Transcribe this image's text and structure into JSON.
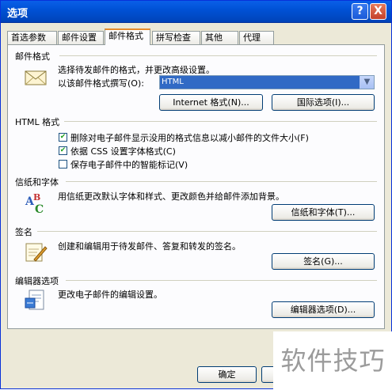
{
  "window": {
    "title": "选项"
  },
  "titlebar": {
    "help_label": "?",
    "close_label": "X"
  },
  "tabs": [
    {
      "label": "首选参数"
    },
    {
      "label": "邮件设置"
    },
    {
      "label": "邮件格式"
    },
    {
      "label": "拼写检查"
    },
    {
      "label": "其他"
    },
    {
      "label": "代理"
    }
  ],
  "mail_format": {
    "title": "邮件格式",
    "desc": "选择待发邮件的格式，并更改高级设置。",
    "compose_label": "以该邮件格式撰写(O):",
    "compose_value": "HTML",
    "internet_button": "Internet 格式(N)...",
    "international_button": "国际选项(I)..."
  },
  "html_format": {
    "title": "HTML 格式",
    "options": [
      {
        "label": "删除对电子邮件显示没用的格式信息以减小邮件的文件大小(F)",
        "checked": true
      },
      {
        "label": "依据 CSS 设置字体格式(C)",
        "checked": true
      },
      {
        "label": "保存电子邮件中的智能标记(V)",
        "checked": false
      }
    ]
  },
  "stationery": {
    "title": "信纸和字体",
    "desc": "用信纸更改默认字体和样式、更改颜色并给邮件添加背景。",
    "button": "信纸和字体(T)..."
  },
  "signature": {
    "title": "签名",
    "desc": "创建和编辑用于待发邮件、答复和转发的签名。",
    "button": "签名(G)..."
  },
  "editor": {
    "title": "编辑器选项",
    "desc": "更改电子邮件的编辑设置。",
    "button": "编辑器选项(D)..."
  },
  "footer": {
    "ok_label": "确定"
  },
  "watermark": {
    "text": "软件技巧"
  }
}
